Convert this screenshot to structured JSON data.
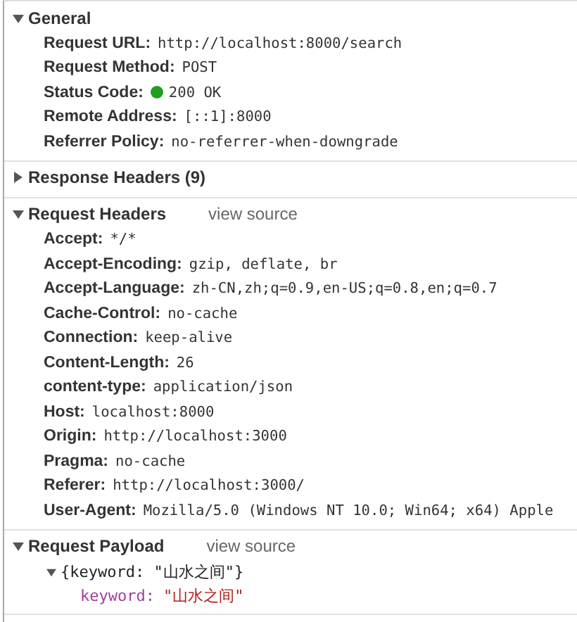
{
  "sections": [
    {
      "title": "General",
      "expanded": true,
      "rows": [
        {
          "name": "Request URL:",
          "value": "http://localhost:8000/search"
        },
        {
          "name": "Request Method:",
          "value": "POST"
        },
        {
          "name": "Status Code:",
          "value": "200 OK",
          "kind": "status",
          "color": "#1e9e1e"
        },
        {
          "name": "Remote Address:",
          "value": "[::1]:8000"
        },
        {
          "name": "Referrer Policy:",
          "value": "no-referrer-when-downgrade"
        }
      ]
    },
    {
      "title": "Response Headers (9)",
      "expanded": false
    },
    {
      "title": "Request Headers",
      "expanded": true,
      "link": "view source",
      "rows": [
        {
          "name": "Accept:",
          "value": "*/*"
        },
        {
          "name": "Accept-Encoding:",
          "value": "gzip, deflate, br"
        },
        {
          "name": "Accept-Language:",
          "value": "zh-CN,zh;q=0.9,en-US;q=0.8,en;q=0.7"
        },
        {
          "name": "Cache-Control:",
          "value": "no-cache"
        },
        {
          "name": "Connection:",
          "value": "keep-alive"
        },
        {
          "name": "Content-Length:",
          "value": "26"
        },
        {
          "name": "content-type:",
          "value": "application/json"
        },
        {
          "name": "Host:",
          "value": "localhost:8000"
        },
        {
          "name": "Origin:",
          "value": "http://localhost:3000"
        },
        {
          "name": "Pragma:",
          "value": "no-cache"
        },
        {
          "name": "Referer:",
          "value": "http://localhost:3000/"
        },
        {
          "name": "User-Agent:",
          "value": "Mozilla/5.0 (Windows NT 10.0; Win64; x64) Apple"
        }
      ]
    },
    {
      "title": "Request Payload",
      "expanded": true,
      "link": "view source",
      "tree": {
        "summary": "{keyword: \"山水之间\"}",
        "expanded": true,
        "children": [
          {
            "key": "keyword:",
            "value": "\"山水之间\""
          }
        ]
      }
    }
  ]
}
